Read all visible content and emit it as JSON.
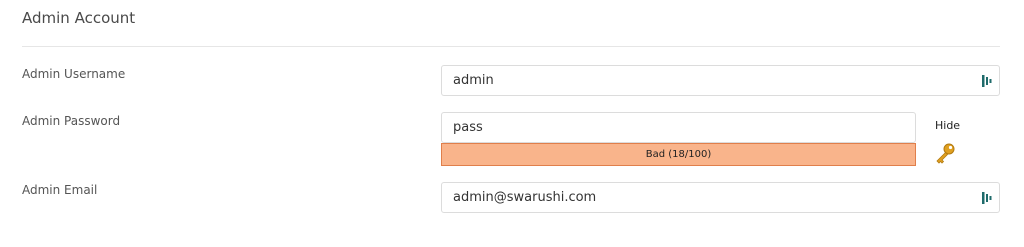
{
  "section": {
    "title": "Admin Account"
  },
  "fields": {
    "username": {
      "label": "Admin Username",
      "value": "admin"
    },
    "password": {
      "label": "Admin Password",
      "value": "pass",
      "strength_text": "Bad (18/100)",
      "strength_score": 18,
      "toggle_label": "Hide"
    },
    "email": {
      "label": "Admin Email",
      "value": "admin@swarushi.com"
    }
  },
  "icons": {
    "field_icon": "password-manager-icon",
    "generate_icon": "key-icon"
  },
  "colors": {
    "strength_fill": "#f9b48b",
    "strength_border": "#e07f4b",
    "field_icon": "#1f6b6b",
    "key_icon": "#e0a020"
  }
}
